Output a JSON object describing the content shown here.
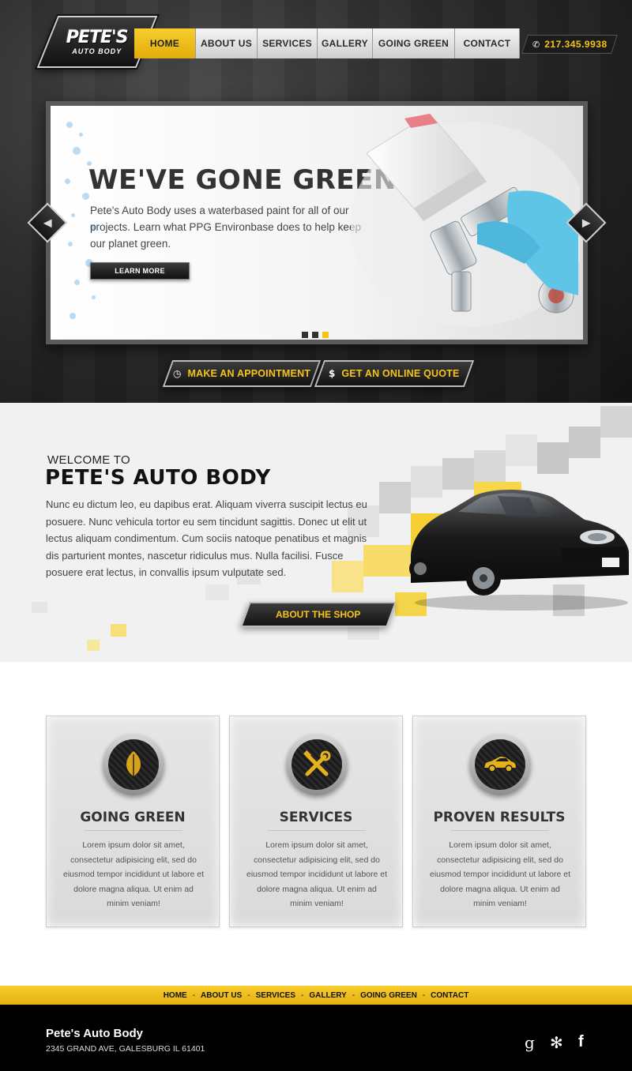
{
  "brand": {
    "logo_name": "PETE'S",
    "logo_sub": "AUTO BODY"
  },
  "nav": {
    "items": [
      {
        "label": "HOME",
        "active": true
      },
      {
        "label": "ABOUT US",
        "active": false
      },
      {
        "label": "SERVICES",
        "active": false
      },
      {
        "label": "GALLERY",
        "active": false
      },
      {
        "label": "GOING GREEN",
        "active": false
      },
      {
        "label": "CONTACT",
        "active": false
      }
    ],
    "phone_icon": "phone-icon",
    "phone": "217.345.9938"
  },
  "slider": {
    "title": "WE'VE GONE GREEN.",
    "text": "Pete's Auto Body uses a waterbased paint for all of our projects. Learn what PPG Environbase does to help keep our planet green.",
    "button": "LEARN MORE",
    "slide_count": 3,
    "active_slide": 3,
    "prev_icon": "chevron-left-icon",
    "next_icon": "chevron-right-icon"
  },
  "cta": {
    "appointment_icon": "clock-icon",
    "appointment": "MAKE AN APPOINTMENT",
    "quote_icon": "dollar-icon",
    "quote": "GET AN ONLINE QUOTE"
  },
  "welcome": {
    "kicker": "WELCOME TO",
    "title": "PETE'S AUTO BODY",
    "text": "Nunc eu dictum leo, eu dapibus erat. Aliquam viverra suscipit lectus eu posuere. Nunc vehicula tortor eu sem tincidunt sagittis. Donec ut elit ut lectus aliquam condimentum. Cum sociis natoque penatibus et magnis dis parturient montes, nascetur ridiculus mus. Nulla facilisi. Fusce posuere erat lectus, in convallis ipsum vulputate sed.",
    "button": "ABOUT THE SHOP"
  },
  "features": [
    {
      "icon": "leaf-icon",
      "title": "GOING GREEN",
      "text": "Lorem ipsum dolor sit amet, consectetur adipisicing elit, sed do eiusmod tempor incididunt ut labore et dolore magna aliqua. Ut enim ad minim veniam!"
    },
    {
      "icon": "wrench-icon",
      "title": "SERVICES",
      "text": "Lorem ipsum dolor sit amet, consectetur adipisicing elit, sed do eiusmod tempor incididunt ut labore et dolore magna aliqua. Ut enim ad minim veniam!"
    },
    {
      "icon": "car-icon",
      "title": "PROVEN RESULTS",
      "text": "Lorem ipsum dolor sit amet, consectetur adipisicing elit, sed do eiusmod tempor incididunt ut labore et dolore magna aliqua. Ut enim ad minim veniam!"
    }
  ],
  "footer_nav": [
    "HOME",
    "ABOUT US",
    "SERVICES",
    "GALLERY",
    "GOING GREEN",
    "CONTACT"
  ],
  "footer": {
    "name": "Pete's Auto Body",
    "address": "2345 GRAND AVE, GALESBURG IL 61401",
    "social": [
      {
        "icon": "google-plus-icon",
        "glyph": "g"
      },
      {
        "icon": "yelp-icon",
        "glyph": "✻"
      },
      {
        "icon": "facebook-icon",
        "glyph": "f"
      }
    ]
  },
  "colors": {
    "accent": "#f5c31a",
    "dark": "#1a1a1a",
    "light_bg": "#f1f1f1"
  }
}
